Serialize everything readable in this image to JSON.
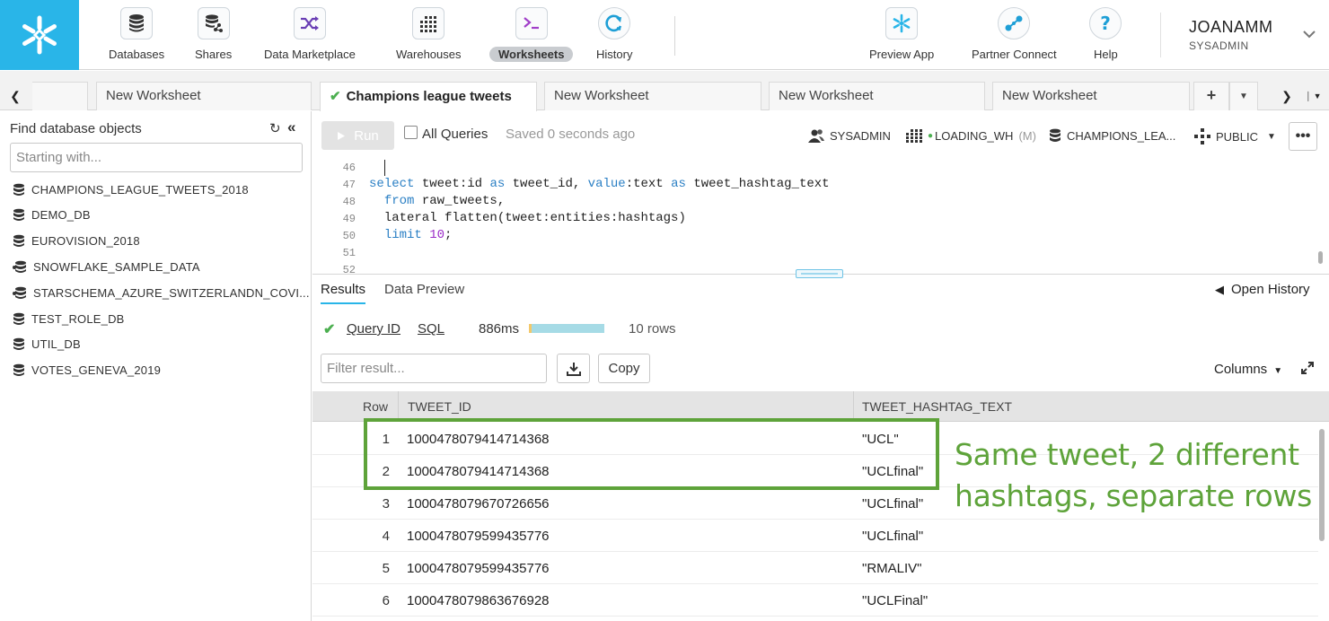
{
  "nav": {
    "items": [
      {
        "label": "Databases",
        "icon": "database-stack-icon"
      },
      {
        "label": "Shares",
        "icon": "shares-icon"
      },
      {
        "label": "Data Marketplace",
        "icon": "shuffle-icon"
      },
      {
        "label": "Warehouses",
        "icon": "warehouse-grid-icon"
      },
      {
        "label": "Worksheets",
        "icon": "terminal-icon"
      },
      {
        "label": "History",
        "icon": "history-icon"
      },
      {
        "label": "Preview App",
        "icon": "snowflake-icon"
      },
      {
        "label": "Partner Connect",
        "icon": "partner-connect-icon"
      },
      {
        "label": "Help",
        "icon": "help-icon"
      }
    ],
    "active": "Worksheets",
    "user_name": "JOANAMM",
    "user_role": "SYSADMIN",
    "brand_color": "#29b5e8"
  },
  "tabs": {
    "items": [
      "New Worksheet",
      "Champions league tweets",
      "New Worksheet",
      "New Worksheet",
      "New Worksheet"
    ],
    "active_index": 1,
    "add_label": "+"
  },
  "sidebar": {
    "title": "Find database objects",
    "search_placeholder": "Starting with...",
    "databases": [
      "CHAMPIONS_LEAGUE_TWEETS_2018",
      "DEMO_DB",
      "EUROVISION_2018",
      "SNOWFLAKE_SAMPLE_DATA",
      "STARSCHEMA_AZURE_SWITZERLANDN_COVI...",
      "TEST_ROLE_DB",
      "UTIL_DB",
      "VOTES_GENEVA_2019"
    ]
  },
  "toolbar": {
    "run_label": "Run",
    "all_queries_label": "All Queries",
    "saved_text": "Saved 0 seconds ago",
    "role": "SYSADMIN",
    "warehouse": "LOADING_WH",
    "warehouse_size": "(M)",
    "database": "CHAMPIONS_LEA...",
    "schema": "PUBLIC",
    "more_label": "•••"
  },
  "editor": {
    "lines": [
      {
        "num": "46",
        "text": ""
      },
      {
        "num": "47",
        "text": "select tweet:id as tweet_id, value:text as tweet_hashtag_text"
      },
      {
        "num": "48",
        "text": "  from raw_tweets,"
      },
      {
        "num": "49",
        "text": "  lateral flatten(tweet:entities:hashtags)"
      },
      {
        "num": "50",
        "text": "  limit 10;"
      },
      {
        "num": "51",
        "text": ""
      },
      {
        "num": "52",
        "text": ""
      }
    ]
  },
  "results": {
    "tab_results": "Results",
    "tab_preview": "Data Preview",
    "open_history": "Open History",
    "query_id_label": "Query ID",
    "sql_label": "SQL",
    "duration": "886ms",
    "row_count": "10 rows",
    "filter_placeholder": "Filter result...",
    "copy_label": "Copy",
    "columns_label": "Columns",
    "headers": [
      "Row",
      "TWEET_ID",
      "TWEET_HASHTAG_TEXT"
    ],
    "rows": [
      {
        "row": "1",
        "tweet_id": "1000478079414714368",
        "hashtag": "\"UCL\""
      },
      {
        "row": "2",
        "tweet_id": "1000478079414714368",
        "hashtag": "\"UCLfinal\""
      },
      {
        "row": "3",
        "tweet_id": "1000478079670726656",
        "hashtag": "\"UCLfinal\""
      },
      {
        "row": "4",
        "tweet_id": "1000478079599435776",
        "hashtag": "\"UCLfinal\""
      },
      {
        "row": "5",
        "tweet_id": "1000478079599435776",
        "hashtag": "\"RMALIV\""
      },
      {
        "row": "6",
        "tweet_id": "1000478079863676928",
        "hashtag": "\"UCLFinal\""
      }
    ]
  },
  "annotation": {
    "text_line1": "Same tweet, 2 different",
    "text_line2": "hashtags, separate rows",
    "color": "#5ea33a"
  }
}
